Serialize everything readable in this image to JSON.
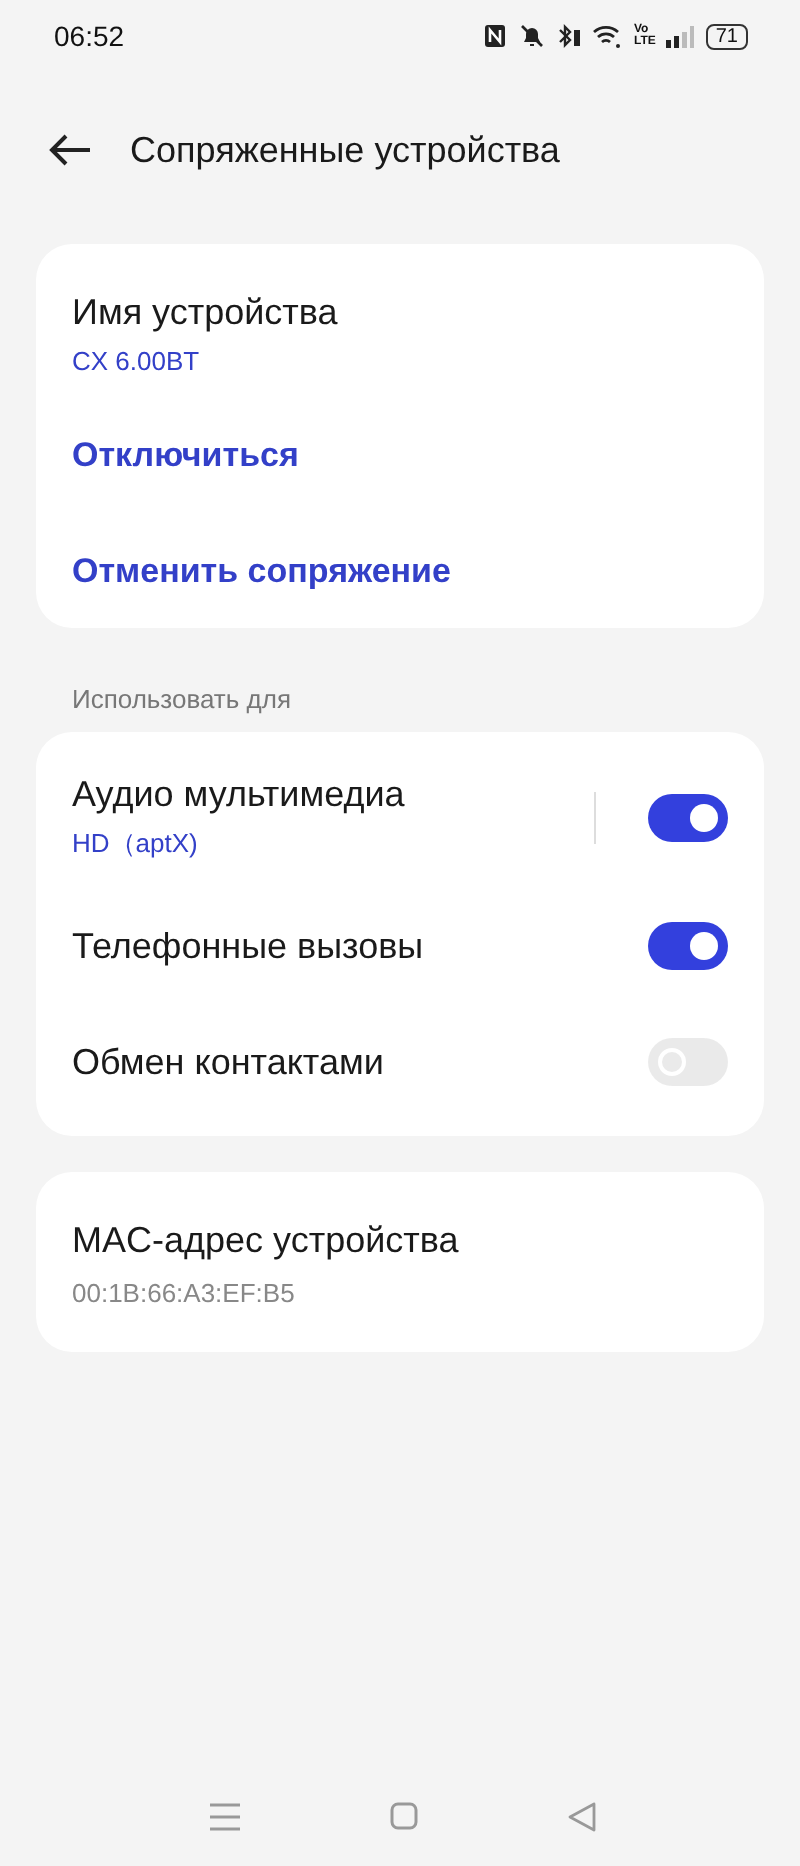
{
  "status_bar": {
    "time": "06:52",
    "volte": [
      "Vo",
      "LTE"
    ],
    "battery": "71"
  },
  "header": {
    "title": "Сопряженные устройства"
  },
  "device_card": {
    "name_label": "Имя устройства",
    "name_value": "CX 6.00BT",
    "actions": [
      "Отключиться",
      "Отменить сопряжение"
    ]
  },
  "use_for": {
    "label": "Использовать для",
    "items": [
      {
        "title": "Аудио мультимедиа",
        "subtitle": "HD（aptX)",
        "on": true,
        "disabled": false
      },
      {
        "title": "Телефонные вызовы",
        "on": true,
        "disabled": false
      },
      {
        "title": "Обмен контактами",
        "on": false,
        "disabled": true
      }
    ]
  },
  "mac_card": {
    "label": "MAC-адрес устройства",
    "value": "00:1B:66:A3:EF:B5"
  }
}
